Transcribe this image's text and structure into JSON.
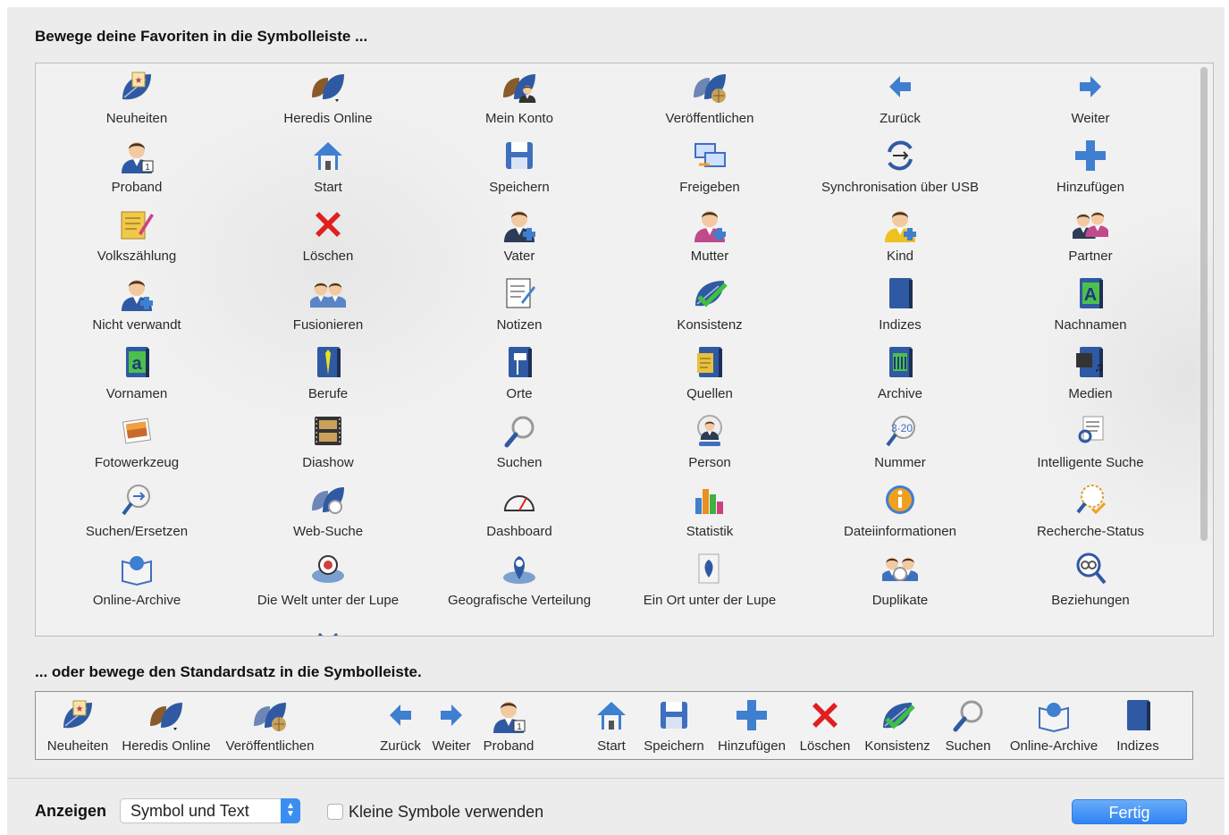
{
  "favorites_heading": "Bewege deine Favoriten in die Symbolleiste ...",
  "default_heading": "... oder bewege den Standardsatz in die Symbolleiste.",
  "favorites": [
    {
      "label": "Neuheiten",
      "icon": "news-leaf-icon"
    },
    {
      "label": "Heredis Online",
      "icon": "heredis-online-icon"
    },
    {
      "label": "Mein Konto",
      "icon": "my-account-icon"
    },
    {
      "label": "Veröffentlichen",
      "icon": "publish-icon"
    },
    {
      "label": "Zurück",
      "icon": "arrow-left-icon"
    },
    {
      "label": "Weiter",
      "icon": "arrow-right-icon"
    },
    {
      "label": "Proband",
      "icon": "proband-icon"
    },
    {
      "label": "Start",
      "icon": "home-icon"
    },
    {
      "label": "Speichern",
      "icon": "save-icon"
    },
    {
      "label": "Freigeben",
      "icon": "share-icon"
    },
    {
      "label": "Synchronisation über USB",
      "icon": "usb-sync-icon"
    },
    {
      "label": "Hinzufügen",
      "icon": "add-icon"
    },
    {
      "label": "Volkszählung",
      "icon": "census-icon"
    },
    {
      "label": "Löschen",
      "icon": "delete-icon"
    },
    {
      "label": "Vater",
      "icon": "father-icon"
    },
    {
      "label": "Mutter",
      "icon": "mother-icon"
    },
    {
      "label": "Kind",
      "icon": "child-icon"
    },
    {
      "label": "Partner",
      "icon": "partner-icon"
    },
    {
      "label": "Nicht verwandt",
      "icon": "unrelated-icon"
    },
    {
      "label": "Fusionieren",
      "icon": "merge-icon"
    },
    {
      "label": "Notizen",
      "icon": "notes-icon"
    },
    {
      "label": "Konsistenz",
      "icon": "consistency-icon"
    },
    {
      "label": "Indizes",
      "icon": "index-book-icon"
    },
    {
      "label": "Nachnamen",
      "icon": "surnames-icon"
    },
    {
      "label": "Vornamen",
      "icon": "first-names-icon"
    },
    {
      "label": "Berufe",
      "icon": "occupations-icon"
    },
    {
      "label": "Orte",
      "icon": "places-icon"
    },
    {
      "label": "Quellen",
      "icon": "sources-icon"
    },
    {
      "label": "Archive",
      "icon": "archives-icon"
    },
    {
      "label": "Medien",
      "icon": "media-icon"
    },
    {
      "label": "Fotowerkzeug",
      "icon": "photo-tool-icon"
    },
    {
      "label": "Diashow",
      "icon": "slideshow-icon"
    },
    {
      "label": "Suchen",
      "icon": "search-icon"
    },
    {
      "label": "Person",
      "icon": "person-icon"
    },
    {
      "label": "Nummer",
      "icon": "number-icon"
    },
    {
      "label": "Intelligente Suche",
      "icon": "smart-search-icon"
    },
    {
      "label": "Suchen/Ersetzen",
      "icon": "search-replace-icon"
    },
    {
      "label": "Web-Suche",
      "icon": "web-search-icon"
    },
    {
      "label": "Dashboard",
      "icon": "dashboard-gauge-icon"
    },
    {
      "label": "Statistik",
      "icon": "statistics-icon"
    },
    {
      "label": "Dateiinformationen",
      "icon": "info-icon"
    },
    {
      "label": "Recherche-Status",
      "icon": "research-status-icon"
    },
    {
      "label": "Online-Archive",
      "icon": "online-archives-icon"
    },
    {
      "label": "Die Welt unter der Lupe",
      "icon": "world-magnifier-icon"
    },
    {
      "label": "Geografische Verteilung",
      "icon": "geo-distribution-icon"
    },
    {
      "label": "Ein Ort unter der Lupe",
      "icon": "place-magnifier-icon"
    },
    {
      "label": "Duplikate",
      "icon": "duplicates-icon"
    },
    {
      "label": "Beziehungen",
      "icon": "relationships-icon"
    }
  ],
  "partial_row_icons": [
    "list-icon",
    "tree-people-icon",
    "card-icon",
    "calendar-icon",
    "family-icon",
    "chart-icon"
  ],
  "default_set": [
    {
      "label": "Neuheiten",
      "icon": "news-leaf-icon"
    },
    {
      "label": "Heredis Online",
      "icon": "heredis-online-icon"
    },
    {
      "label": "Veröffentlichen",
      "icon": "publish-icon"
    },
    {
      "label": "Zurück",
      "icon": "arrow-left-icon"
    },
    {
      "label": "Weiter",
      "icon": "arrow-right-icon"
    },
    {
      "label": "Proband",
      "icon": "proband-icon"
    },
    {
      "label": "Start",
      "icon": "home-icon"
    },
    {
      "label": "Speichern",
      "icon": "save-icon"
    },
    {
      "label": "Hinzufügen",
      "icon": "add-icon"
    },
    {
      "label": "Löschen",
      "icon": "delete-icon"
    },
    {
      "label": "Konsistenz",
      "icon": "consistency-icon"
    },
    {
      "label": "Suchen",
      "icon": "search-icon"
    },
    {
      "label": "Online-Archive",
      "icon": "online-archives-icon"
    },
    {
      "label": "Indizes",
      "icon": "index-book-icon"
    }
  ],
  "footer": {
    "show_label": "Anzeigen",
    "show_value": "Symbol und Text",
    "small_icons_label": "Kleine Symbole verwenden",
    "small_icons_checked": false,
    "done_label": "Fertig"
  },
  "colors": {
    "accent": "#3b8ef0",
    "background": "#ececec"
  }
}
